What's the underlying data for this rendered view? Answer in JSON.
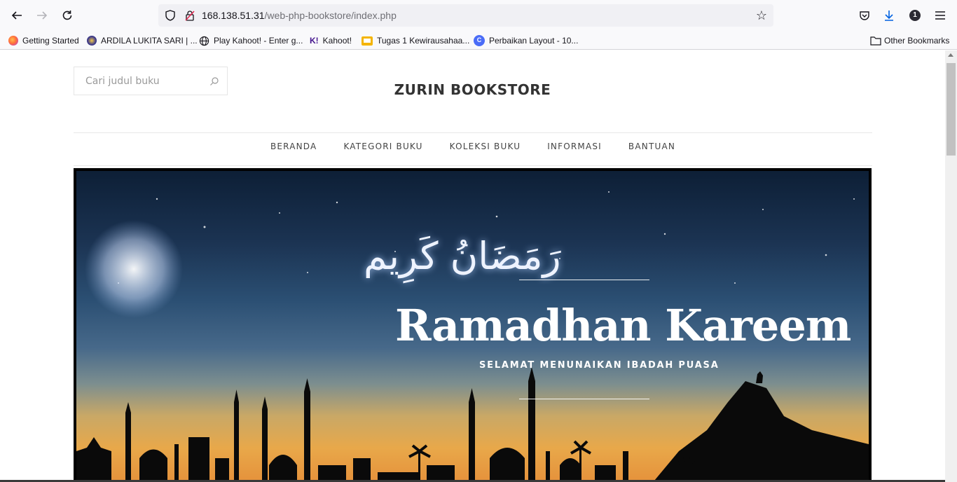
{
  "browser": {
    "url_host": "168.138.51.31",
    "url_path": "/web-php-bookstore/index.php",
    "notification_count": "1",
    "bookmarks": [
      {
        "label": "Getting Started",
        "icon": "firefox-icon"
      },
      {
        "label": "ARDILA LUKITA SARI | ...",
        "icon": "seal-icon"
      },
      {
        "label": "Play Kahoot! - Enter g...",
        "icon": "globe-icon"
      },
      {
        "label": "Kahoot!",
        "icon": "kahoot-icon"
      },
      {
        "label": "Tugas 1 Kewirausahaa...",
        "icon": "slides-icon"
      },
      {
        "label": "Perbaikan Layout - 10...",
        "icon": "c-icon"
      }
    ],
    "other_bookmarks": "Other Bookmarks"
  },
  "site": {
    "search_placeholder": "Cari judul buku",
    "title": "ZURIN BOOKSTORE",
    "nav": [
      "BERANDA",
      "KATEGORI BUKU",
      "KOLEKSI BUKU",
      "INFORMASI",
      "BANTUAN"
    ]
  },
  "hero": {
    "arabic": "رَمَضَانُ كَرِيم",
    "title": "Ramadhan Kareem",
    "subtitle": "SELAMAT MENUNAIKAN IBADAH PUASA"
  },
  "colors": {
    "accent_download": "#0061e0",
    "site_text": "#333333"
  }
}
